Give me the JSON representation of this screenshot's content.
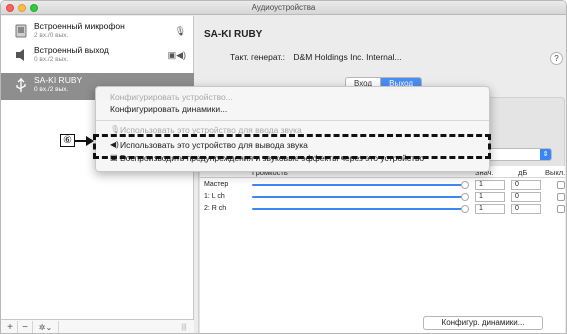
{
  "window": {
    "title": "Аудиоустройства"
  },
  "sidebar": {
    "devices": [
      {
        "name": "Встроенный микрофон",
        "sub": "2 вх./0 вых.",
        "icon": "microphone-icon",
        "right": "🎙"
      },
      {
        "name": "Встроенный выход",
        "sub": "0 вх./2 вых.",
        "icon": "speaker-icon",
        "right": "▣◀)"
      },
      {
        "name": "SA-KI RUBY",
        "sub": "0 вх./2 вых.",
        "icon": "usb-icon",
        "right": ""
      }
    ],
    "footer": {
      "add": "+",
      "remove": "−",
      "gear": "✲⌄",
      "grip": "|||"
    }
  },
  "main": {
    "device_title": "SA-KI RUBY",
    "clock_label": "Такт. генерат.:",
    "clock_value": "D&M Holdings Inc. Internal...",
    "help": "?",
    "tabs": {
      "input": "Вход",
      "output": "Выход"
    },
    "table": {
      "headers": {
        "volume": "Громкость",
        "value": "Знач.",
        "db": "дБ",
        "mute": "Выкл."
      },
      "rows": [
        {
          "label": "Мастер",
          "value": "1",
          "db": "0"
        },
        {
          "label": "1: L ch",
          "value": "1",
          "db": "0"
        },
        {
          "label": "2: R ch",
          "value": "1",
          "db": "0"
        }
      ]
    },
    "configure_speakers_button": "Конфигур. динамики..."
  },
  "context_menu": {
    "items": [
      {
        "label": "Конфигурировать устройство...",
        "enabled": false
      },
      {
        "label": "Конфигурировать динамики...",
        "enabled": true
      },
      {
        "label": "Использовать это устройство для ввода звука",
        "enabled": false
      },
      {
        "label": "Использовать это устройство для вывода звука",
        "enabled": true
      },
      {
        "label": "Воспроизводить предупреждения и звуковые эффекты через это устройство",
        "enabled": true
      }
    ]
  },
  "annotation": {
    "callout": "⑥"
  },
  "colors": {
    "accent": "#4a8ef5",
    "selected_row": "#8e8e8e"
  }
}
